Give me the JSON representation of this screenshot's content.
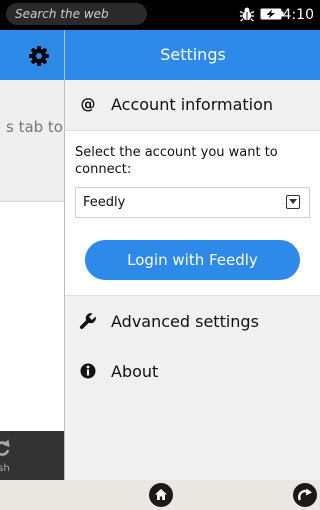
{
  "status_bar": {
    "search_placeholder": "Search the web",
    "time": "4:10",
    "icons": [
      "bug-icon",
      "battery-charging-icon"
    ]
  },
  "background_app": {
    "hint_text": "s tab to",
    "toolbar_label": "esh",
    "icons": [
      "gear-icon",
      "refresh-icon"
    ]
  },
  "settings": {
    "title": "Settings",
    "account": {
      "icon": "at-sign-icon",
      "label": "Account information",
      "prompt": "Select the account you want to connect:",
      "selected": "Feedly",
      "login_label": "Login with Feedly"
    },
    "advanced": {
      "icon": "wrench-icon",
      "label": "Advanced settings"
    },
    "about": {
      "icon": "info-icon",
      "label": "About"
    }
  },
  "bottom_bar": {
    "icons": [
      "home-icon",
      "forward-icon"
    ]
  },
  "colors": {
    "accent": "#2d8ae8",
    "drawer_bg": "#f0f0f0",
    "status_bg": "#000000",
    "bottom_bg": "#ebe8e3"
  }
}
